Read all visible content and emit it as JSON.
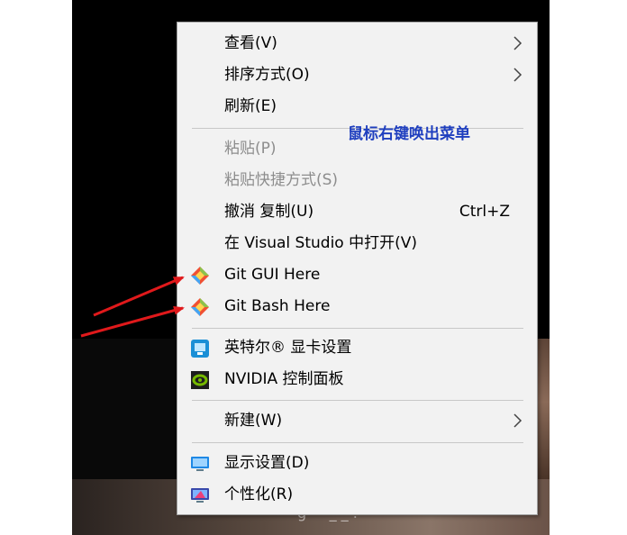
{
  "menu": {
    "items": [
      {
        "label": "查看(V)",
        "submenu": true
      },
      {
        "label": "排序方式(O)",
        "submenu": true
      },
      {
        "label": "刷新(E)"
      },
      {
        "label": "粘贴(P)",
        "disabled": true
      },
      {
        "label": "粘贴快捷方式(S)",
        "disabled": true
      },
      {
        "label": "撤消 复制(U)",
        "shortcut": "Ctrl+Z"
      },
      {
        "label": "在 Visual Studio 中打开(V)"
      },
      {
        "label": "Git GUI Here",
        "icon": "git-icon"
      },
      {
        "label": "Git Bash Here",
        "icon": "git-icon"
      },
      {
        "label": "英特尔® 显卡设置",
        "icon": "intel-graphics-icon"
      },
      {
        "label": "NVIDIA 控制面板",
        "icon": "nvidia-icon"
      },
      {
        "label": "新建(W)",
        "submenu": true
      },
      {
        "label": "显示设置(D)",
        "icon": "display-settings-icon"
      },
      {
        "label": "个性化(R)",
        "icon": "personalize-icon"
      }
    ]
  },
  "annotation": {
    "text": "鼠标右键唤出菜单",
    "color": "#1f3fbf"
  },
  "background_text": "g   ·  · _  _ .",
  "colors": {
    "menu_bg": "#f2f2f2",
    "disabled_text": "#8d8d8d",
    "arrow": "#e0191b"
  }
}
